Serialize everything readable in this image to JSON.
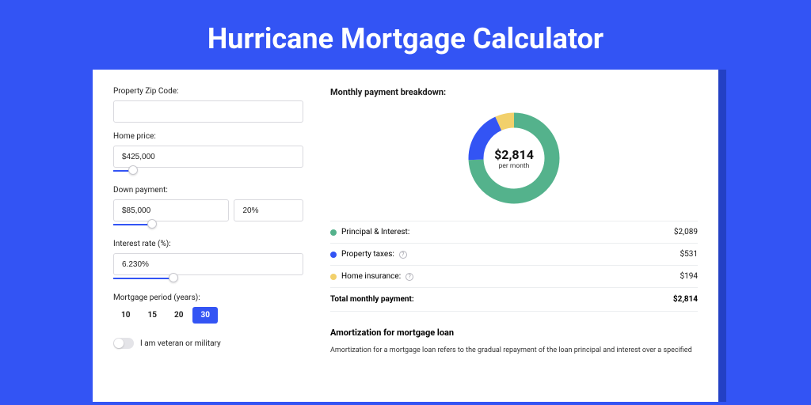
{
  "page": {
    "title": "Hurricane Mortgage Calculator"
  },
  "form": {
    "zip_label": "Property Zip Code:",
    "zip_value": "",
    "home_price_label": "Home price:",
    "home_price_value": "$425,000",
    "down_payment_label": "Down payment:",
    "down_payment_value": "$85,000",
    "down_payment_pct": "20%",
    "interest_label": "Interest rate (%):",
    "interest_value": "6.230%",
    "period_label": "Mortgage period (years):",
    "periods": [
      "10",
      "15",
      "20",
      "30"
    ],
    "period_selected": "30",
    "veteran_label": "I am veteran or military"
  },
  "breakdown": {
    "title": "Monthly payment breakdown:",
    "center_value": "$2,814",
    "center_sub": "per month",
    "items": [
      {
        "label": "Principal & Interest:",
        "amount": "$2,089",
        "color": "green",
        "info": false
      },
      {
        "label": "Property taxes:",
        "amount": "$531",
        "color": "blue",
        "info": true
      },
      {
        "label": "Home insurance:",
        "amount": "$194",
        "color": "yellow",
        "info": true
      }
    ],
    "total_label": "Total monthly payment:",
    "total_value": "$2,814"
  },
  "amort": {
    "title": "Amortization for mortgage loan",
    "text": "Amortization for a mortgage loan refers to the gradual repayment of the loan principal and interest over a specified"
  },
  "chart_data": {
    "type": "pie",
    "title": "Monthly payment breakdown",
    "series": [
      {
        "name": "Principal & Interest",
        "value": 2089,
        "color": "#54b28c"
      },
      {
        "name": "Property taxes",
        "value": 531,
        "color": "#3354f4"
      },
      {
        "name": "Home insurance",
        "value": 194,
        "color": "#f2d06b"
      }
    ],
    "total": 2814,
    "center_label": "$2,814 per month"
  }
}
